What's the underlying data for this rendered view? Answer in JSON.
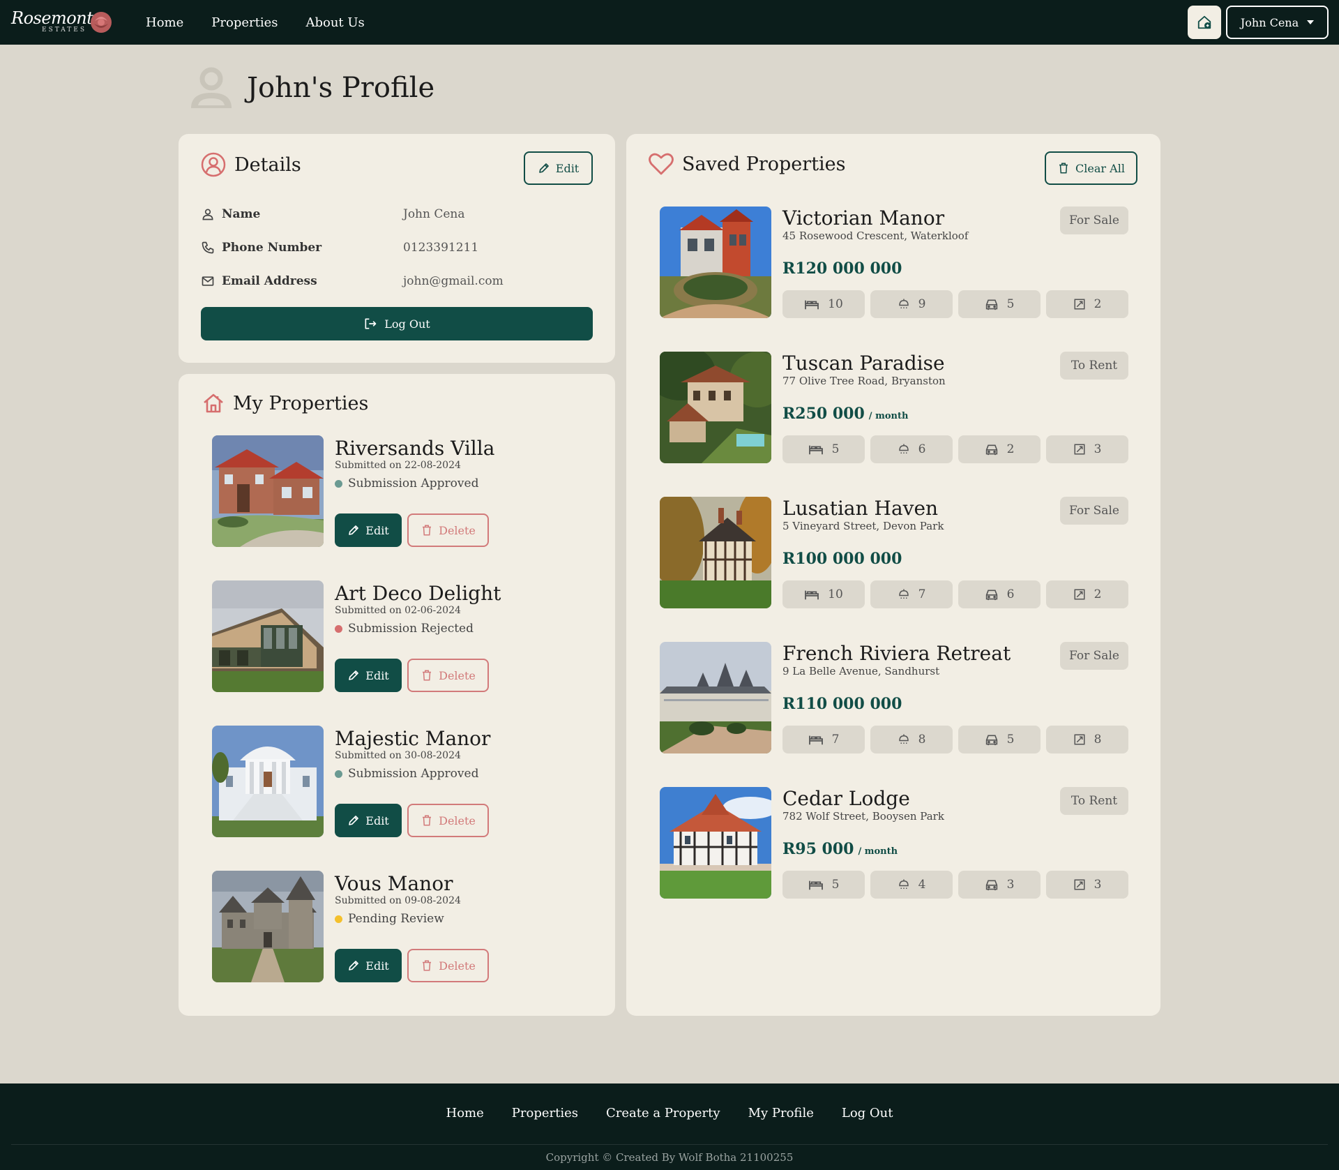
{
  "nav": {
    "logo_text": "Rosemont",
    "logo_sub": "ESTATES",
    "links": [
      "Home",
      "Properties",
      "About Us"
    ],
    "user": "John Cena"
  },
  "page": {
    "title": "John's Profile"
  },
  "details": {
    "title": "Details",
    "edit_label": "Edit",
    "rows": [
      {
        "label": "Name",
        "value": "John Cena"
      },
      {
        "label": "Phone Number",
        "value": "0123391211"
      },
      {
        "label": "Email Address",
        "value": "john@gmail.com"
      }
    ],
    "logout_label": "Log Out"
  },
  "my_properties": {
    "title": "My Properties",
    "edit_label": "Edit",
    "delete_label": "Delete",
    "items": [
      {
        "name": "Riversands Villa",
        "submitted": "Submitted on 22-08-2024",
        "status": "Submission Approved",
        "status_color": "#6b9a92"
      },
      {
        "name": "Art Deco Delight",
        "submitted": "Submitted on 02-06-2024",
        "status": "Submission Rejected",
        "status_color": "#d66e6e"
      },
      {
        "name": "Majestic Manor",
        "submitted": "Submitted on 30-08-2024",
        "status": "Submission Approved",
        "status_color": "#6b9a92"
      },
      {
        "name": "Vous Manor",
        "submitted": "Submitted on 09-08-2024",
        "status": "Pending Review",
        "status_color": "#f4c02c"
      }
    ]
  },
  "saved": {
    "title": "Saved Properties",
    "clear_label": "Clear All",
    "items": [
      {
        "name": "Victorian Manor",
        "address": "45 Rosewood Crescent, Waterkloof",
        "price": "R120 000 000",
        "per": "",
        "tag": "For Sale",
        "beds": "10",
        "baths": "9",
        "garages": "5",
        "size": "2"
      },
      {
        "name": "Tuscan Paradise",
        "address": "77 Olive Tree Road, Bryanston",
        "price": "R250 000",
        "per": "/ month",
        "tag": "To Rent",
        "beds": "5",
        "baths": "6",
        "garages": "2",
        "size": "3"
      },
      {
        "name": "Lusatian Haven",
        "address": "5 Vineyard Street, Devon Park",
        "price": "R100 000 000",
        "per": "",
        "tag": "For Sale",
        "beds": "10",
        "baths": "7",
        "garages": "6",
        "size": "2"
      },
      {
        "name": "French Riviera Retreat",
        "address": "9 La Belle Avenue, Sandhurst",
        "price": "R110 000 000",
        "per": "",
        "tag": "For Sale",
        "beds": "7",
        "baths": "8",
        "garages": "5",
        "size": "8"
      },
      {
        "name": "Cedar Lodge",
        "address": "782 Wolf Street, Booysen Park",
        "price": "R95 000",
        "per": "/ month",
        "tag": "To Rent",
        "beds": "5",
        "baths": "4",
        "garages": "3",
        "size": "3"
      }
    ]
  },
  "footer": {
    "links": [
      "Home",
      "Properties",
      "Create a Property",
      "My Profile",
      "Log Out"
    ],
    "copyright": "Copyright © Created By Wolf Botha 21100255"
  },
  "colors": {
    "primary": "#114d46",
    "nav_bg": "#0b1d1b",
    "accent_rose": "#d66e6e",
    "page_bg": "#dbd7cd",
    "card_bg": "#f2eee4"
  }
}
